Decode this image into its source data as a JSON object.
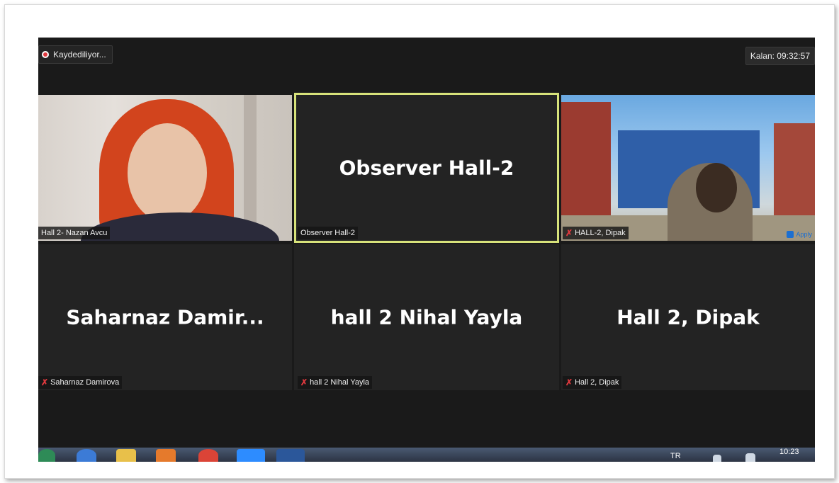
{
  "recording": {
    "label": "Kaydediliyor..."
  },
  "timer": {
    "label": "Kalan: 09:32:57"
  },
  "tiles": [
    {
      "big": "",
      "label": "Hall 2- Nazan Avcu",
      "muted": false
    },
    {
      "big": "Observer Hall-2",
      "label": "Observer Hall-2",
      "muted": false
    },
    {
      "big": "",
      "label": "HALL-2, Dipak",
      "muted": true,
      "extra": "Apply"
    },
    {
      "big": "Saharnaz  Damir...",
      "label": "Saharnaz Damirova",
      "muted": true
    },
    {
      "big": "hall 2 Nihal Yayla",
      "label": "hall 2 Nihal Yayla",
      "muted": true
    },
    {
      "big": "Hall 2, Dipak",
      "label": "Hall 2, Dipak",
      "muted": true
    }
  ],
  "taskbar": {
    "lang": "TR",
    "time": "10:23"
  },
  "colors": {
    "active_border": "#d7e27a",
    "mute": "#e0393e",
    "rec": "#e0393e"
  }
}
